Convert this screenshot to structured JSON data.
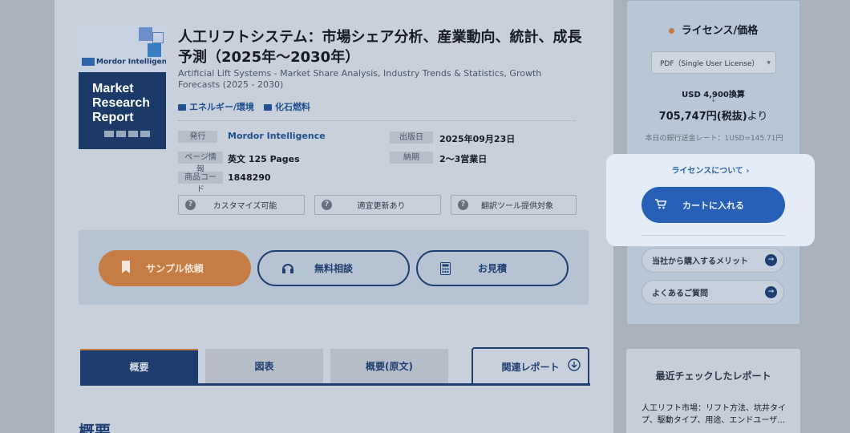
{
  "report": {
    "cover_logo": "Mordor Intelligence",
    "cover_title": "Market Research Report",
    "title": "人工リフトシステム：市場シェア分析、産業動向、統計、成長予測（2025年～2030年）",
    "subtitle": "Artificial Lift Systems - Market Share Analysis, Industry Trends & Statistics, Growth Forecasts (2025 - 2030)",
    "categories": [
      "エネルギー/環境",
      "化石燃料"
    ]
  },
  "meta": {
    "publisher_label": "発行",
    "publisher": "Mordor Intelligence",
    "pages_label": "ページ情報",
    "pages": "英文 125 Pages",
    "code_label": "商品コード",
    "code": "1848290",
    "date_label": "出版日",
    "date": "2025年09月23日",
    "delivery_label": "納期",
    "delivery": "2～3営業日"
  },
  "features": [
    "カスタマイズ可能",
    "適宜更新あり",
    "翻訳ツール提供対象"
  ],
  "actions": {
    "sample": "サンプル依頼",
    "consult": "無料相談",
    "quote": "お見積"
  },
  "tabs": [
    "概要",
    "図表",
    "概要(原文)",
    "関連レポート"
  ],
  "section_heading": "概要",
  "license": {
    "title": "ライセンス/価格",
    "selected": "PDF（Single User License）",
    "usd": "USD 4,900換算",
    "arrow": "↓",
    "jpy": "705,747円(税抜)",
    "yori": "より",
    "rate": "本日の銀行送金レート：1USD=145.71円",
    "about": "ライセンスについて ›",
    "cart": "カートに入れる",
    "merit": "当社から購入するメリット",
    "faq": "よくあるご質問"
  },
  "recent": {
    "title": "最近チェックしたレポート",
    "item": "人工リフト市場：リフト方法、坑井タイプ、駆動タイプ、用途、エンドユーザ…"
  },
  "colors": {
    "accent_orange": "#c57d45",
    "navy": "#1d3d6e",
    "cart_blue": "#2760b6"
  }
}
